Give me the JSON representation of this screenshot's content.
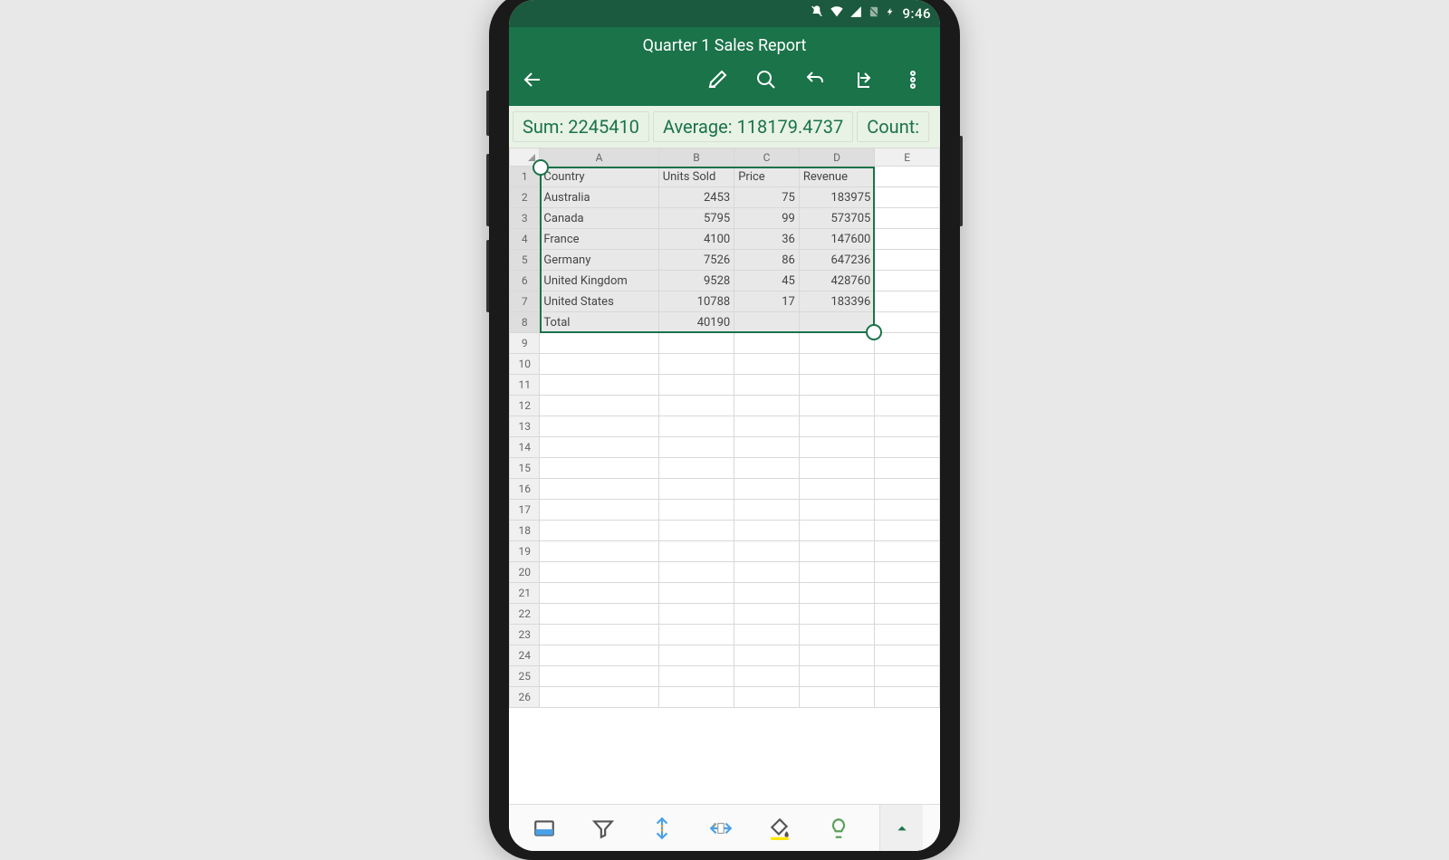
{
  "statusbar": {
    "time": "9:46"
  },
  "header": {
    "title": "Quarter 1 Sales Report"
  },
  "stats": {
    "sum_label": "Sum: 2245410",
    "avg_label": "Average: 118179.4737",
    "count_label": "Count:"
  },
  "columns": [
    "A",
    "B",
    "C",
    "D",
    "E"
  ],
  "row_count": 26,
  "table": {
    "headers": [
      "Country",
      "Units Sold",
      "Price",
      "Revenue"
    ],
    "rows": [
      {
        "country": "Australia",
        "units": "2453",
        "price": "75",
        "revenue": "183975"
      },
      {
        "country": "Canada",
        "units": "5795",
        "price": "99",
        "revenue": "573705"
      },
      {
        "country": "France",
        "units": "4100",
        "price": "36",
        "revenue": "147600"
      },
      {
        "country": "Germany",
        "units": "7526",
        "price": "86",
        "revenue": "647236"
      },
      {
        "country": "United Kingdom",
        "units": "9528",
        "price": "45",
        "revenue": "428760"
      },
      {
        "country": "United States",
        "units": "10788",
        "price": "17",
        "revenue": "183396"
      }
    ],
    "total_label": "Total",
    "total_units": "40190"
  },
  "selection": {
    "from": "A1",
    "to": "D8"
  },
  "colors": {
    "brand": "#1a7349"
  }
}
